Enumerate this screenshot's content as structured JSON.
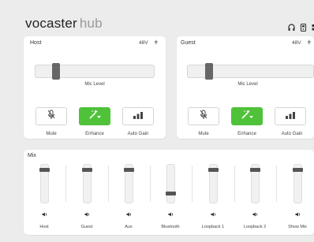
{
  "app": {
    "brand_main": "vocaster",
    "brand_sub": "hub"
  },
  "top_icons": [
    "headphones-icon",
    "device-icon",
    "grid-icon"
  ],
  "inputs": [
    {
      "title": "Host",
      "phantom_label": "48V",
      "phase_label": "ⲫ",
      "mic_level_label": "Mic Level",
      "mic_level": 0.15,
      "buttons": [
        {
          "label": "Mute",
          "icon": "mic-off-icon",
          "active": false
        },
        {
          "label": "Enhance",
          "icon": "magic-wand-icon",
          "active": true
        },
        {
          "label": "Auto Gain",
          "icon": "bars-icon",
          "active": false
        }
      ]
    },
    {
      "title": "Guest",
      "phantom_label": "48V",
      "phase_label": "ⲫ",
      "mic_level_label": "Mic Level",
      "mic_level": 0.15,
      "buttons": [
        {
          "label": "Mute",
          "icon": "mic-off-icon",
          "active": false
        },
        {
          "label": "Enhance",
          "icon": "magic-wand-icon",
          "active": true
        },
        {
          "label": "Auto Gain",
          "icon": "bars-icon",
          "active": false
        }
      ]
    }
  ],
  "mix": {
    "title": "Mix",
    "channels": [
      {
        "label": "Host",
        "level": 0.88
      },
      {
        "label": "Guest",
        "level": 0.88
      },
      {
        "label": "Aux",
        "level": 0.88
      },
      {
        "label": "Bluetooth",
        "level": 0.22
      },
      {
        "label": "Loopback 1",
        "level": 0.88
      },
      {
        "label": "Loopback 2",
        "level": 0.88
      },
      {
        "label": "Show Mix",
        "level": 0.88
      }
    ]
  },
  "colors": {
    "accent": "#4fc23a",
    "thumb": "#666666"
  }
}
